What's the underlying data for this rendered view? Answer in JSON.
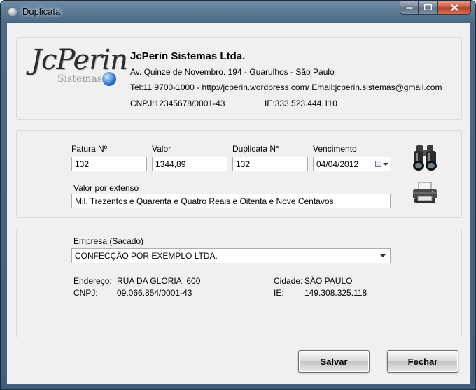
{
  "window": {
    "title": "Duplicata"
  },
  "company": {
    "logo_text": "JcPerin",
    "logo_sub": "Sistemas",
    "name": "JcPerin Sistemas Ltda.",
    "address": "Av. Quinze de Novembro. 194 - Guarulhos - São Paulo",
    "contact": "Tel:11 9700-1000 - http://jcperin.wordpress.com/ Email:jcperin.sistemas@gmail.com",
    "cnpj": "CNPJ:12345678/0001-43",
    "ie": "IE:333.523.444.110"
  },
  "invoice": {
    "fatura_label": "Fatura Nº",
    "fatura_value": "132",
    "valor_label": "Valor",
    "valor_value": "1344,89",
    "duplicata_label": "Duplicata N°",
    "duplicata_value": "132",
    "vencimento_label": "Vencimento",
    "vencimento_value": "04/04/2012",
    "extenso_label": "Valor por extenso",
    "extenso_value": "Mil, Trezentos e Quarenta e Quatro Reais e Oitenta e Nove  Centavos"
  },
  "sacado": {
    "empresa_label": "Empresa (Sacado)",
    "empresa_value": "CONFECÇÃO POR EXEMPLO LTDA.",
    "endereco_label": "Endereço:",
    "endereco_value": "RUA DA GLORIA, 600",
    "cnpj_label": "CNPJ:",
    "cnpj_value": "09.066.854/0001-43",
    "cidade_label": "Cidade:",
    "cidade_value": "SÃO PAULO",
    "ie_label": "IE:",
    "ie_value": "149.308.325.118"
  },
  "buttons": {
    "salvar": "Salvar",
    "fechar": "Fechar"
  },
  "icons": {
    "preview": "binoculars-icon",
    "print": "printer-icon",
    "calendar": "calendar-icon"
  }
}
